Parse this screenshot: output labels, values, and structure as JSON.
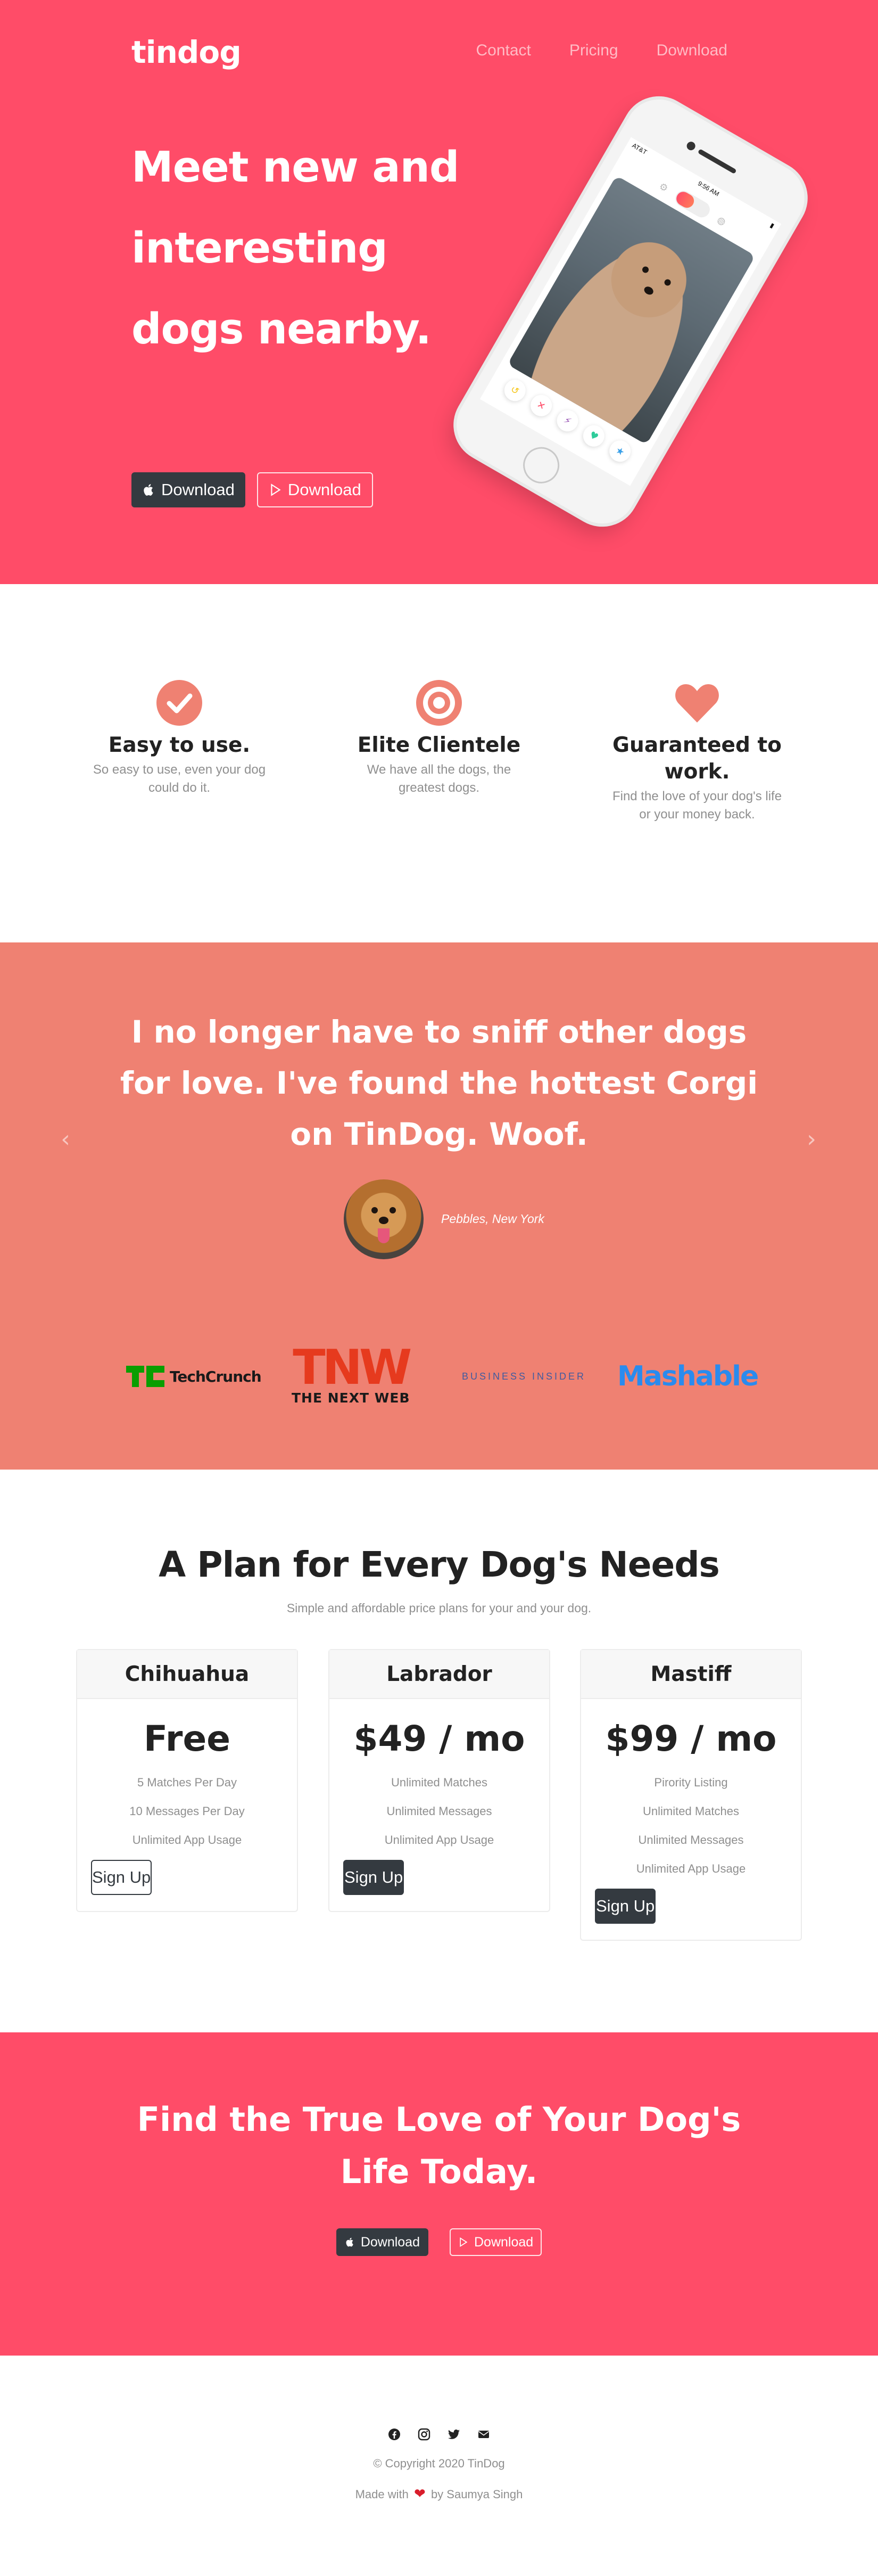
{
  "brand": "tindog",
  "nav": [
    {
      "label": "Contact"
    },
    {
      "label": "Pricing"
    },
    {
      "label": "Download"
    }
  ],
  "hero": {
    "heading": "Meet new and interesting dogs nearby.",
    "download_ios": "Download",
    "download_android": "Download",
    "phone_time": "9:56 AM",
    "phone_carrier": "AT&T"
  },
  "features": [
    {
      "icon": "check-circle-icon",
      "title": "Easy to use.",
      "text": "So easy to use, even your dog could do it."
    },
    {
      "icon": "bullseye-icon",
      "title": "Elite Clientele",
      "text": "We have all the dogs, the greatest dogs."
    },
    {
      "icon": "heart-icon",
      "title": "Guaranteed to work.",
      "text": "Find the love of your dog's life or your money back."
    }
  ],
  "testimonial": {
    "quote": "I no longer have to sniff other dogs for love. I've found the hottest Corgi on TinDog. Woof.",
    "author": "Pebbles, New York"
  },
  "press": {
    "techcrunch": "TechCrunch",
    "tnw_big": "TNW",
    "tnw_small": "THE NEXT WEB",
    "business_insider": "BUSINESS INSIDER",
    "mashable": "Mashable"
  },
  "pricing": {
    "title": "A Plan for Every Dog's Needs",
    "subtitle": "Simple and affordable price plans for your and your dog.",
    "plans": [
      {
        "name": "Chihuahua",
        "price": "Free",
        "features": [
          "5 Matches Per Day",
          "10 Messages Per Day",
          "Unlimited App Usage"
        ],
        "button": "Sign Up"
      },
      {
        "name": "Labrador",
        "price": "$49 / mo",
        "features": [
          "Unlimited Matches",
          "Unlimited Messages",
          "Unlimited App Usage"
        ],
        "button": "Sign Up"
      },
      {
        "name": "Mastiff",
        "price": "$99 / mo",
        "features": [
          "Pirority Listing",
          "Unlimited Matches",
          "Unlimited Messages",
          "Unlimited App Usage"
        ],
        "button": "Sign Up"
      }
    ]
  },
  "cta": {
    "heading": "Find the True Love of Your Dog's Life Today.",
    "download_ios": "Download",
    "download_android": "Download"
  },
  "footer": {
    "social": [
      "facebook-icon",
      "instagram-icon",
      "twitter-icon",
      "envelope-icon"
    ],
    "copyright": "© Copyright 2020 TinDog",
    "made_with_prefix": "Made with",
    "made_with_suffix": "by Saumya Singh"
  },
  "colors": {
    "primary": "#ff4c68",
    "testimonial_bg": "#ef8172",
    "dark": "#343a40",
    "icon_accent": "#ef8172"
  }
}
